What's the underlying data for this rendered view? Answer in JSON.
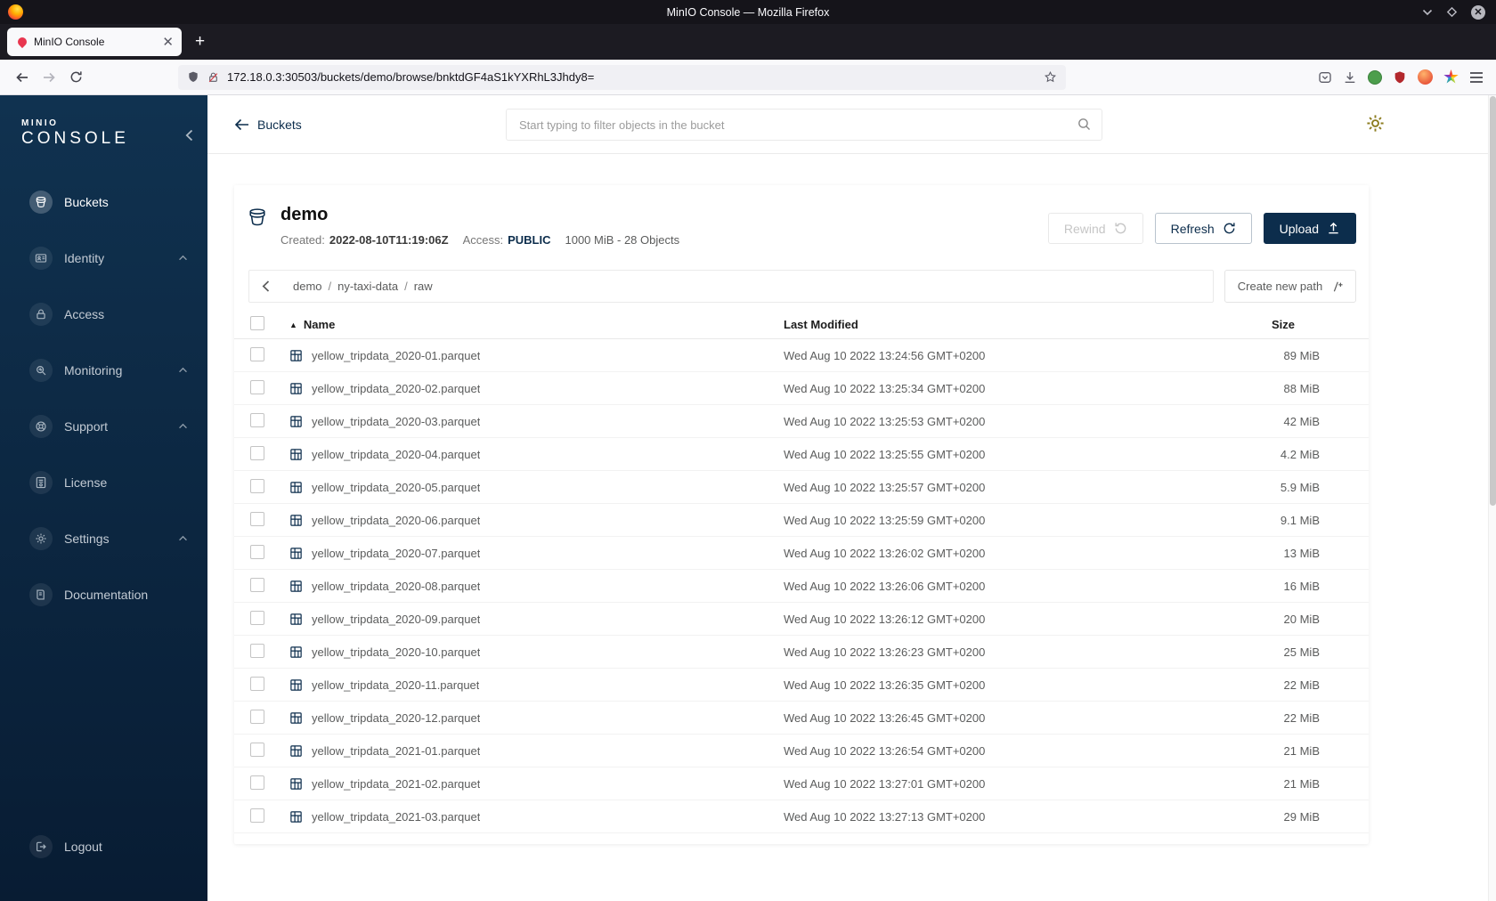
{
  "colors": {
    "accent": "#0C2D4C",
    "sidebar_top": "#103250",
    "sidebar_bottom": "#081C33",
    "gear_gold": "#8D7D20",
    "minio_red": "#E8364F"
  },
  "titlebar": {
    "title": "MinIO Console — Mozilla Firefox"
  },
  "tabbar": {
    "tab_label": "MinIO Console",
    "new_tab_label": "+"
  },
  "navbar": {
    "url": "172.18.0.3:30503/buckets/demo/browse/bnktdGF4aS1kYXRhL3Jhdy8="
  },
  "sidebar": {
    "logo_top": "MINIO",
    "logo_bottom": "CONSOLE",
    "items": [
      {
        "label": "Buckets",
        "active": true,
        "expandable": false
      },
      {
        "label": "Identity",
        "active": false,
        "expandable": true
      },
      {
        "label": "Access",
        "active": false,
        "expandable": false
      },
      {
        "label": "Monitoring",
        "active": false,
        "expandable": true
      },
      {
        "label": "Support",
        "active": false,
        "expandable": true
      },
      {
        "label": "License",
        "active": false,
        "expandable": false
      },
      {
        "label": "Settings",
        "active": false,
        "expandable": true
      },
      {
        "label": "Documentation",
        "active": false,
        "expandable": false
      }
    ],
    "logout_label": "Logout"
  },
  "header": {
    "back_label": "Buckets",
    "search_placeholder": "Start typing to filter objects in the bucket"
  },
  "bucket": {
    "name": "demo",
    "created_label": "Created:",
    "created_value": "2022-08-10T11:19:06Z",
    "access_label": "Access:",
    "access_value": "PUBLIC",
    "usage": "1000 MiB - 28 Objects",
    "rewind_label": "Rewind",
    "refresh_label": "Refresh",
    "upload_label": "Upload"
  },
  "browser": {
    "breadcrumb": [
      "demo",
      "ny-taxi-data",
      "raw"
    ],
    "breadcrumb_separator": "/",
    "create_path_label": "Create new path",
    "sort": "ascending",
    "sort_icon": "▲",
    "columns": {
      "name": "Name",
      "modified": "Last Modified",
      "size": "Size"
    },
    "rows": [
      {
        "name": "yellow_tripdata_2020-01.parquet",
        "modified": "Wed Aug 10 2022 13:24:56 GMT+0200",
        "size": "89 MiB"
      },
      {
        "name": "yellow_tripdata_2020-02.parquet",
        "modified": "Wed Aug 10 2022 13:25:34 GMT+0200",
        "size": "88 MiB"
      },
      {
        "name": "yellow_tripdata_2020-03.parquet",
        "modified": "Wed Aug 10 2022 13:25:53 GMT+0200",
        "size": "42 MiB"
      },
      {
        "name": "yellow_tripdata_2020-04.parquet",
        "modified": "Wed Aug 10 2022 13:25:55 GMT+0200",
        "size": "4.2 MiB"
      },
      {
        "name": "yellow_tripdata_2020-05.parquet",
        "modified": "Wed Aug 10 2022 13:25:57 GMT+0200",
        "size": "5.9 MiB"
      },
      {
        "name": "yellow_tripdata_2020-06.parquet",
        "modified": "Wed Aug 10 2022 13:25:59 GMT+0200",
        "size": "9.1 MiB"
      },
      {
        "name": "yellow_tripdata_2020-07.parquet",
        "modified": "Wed Aug 10 2022 13:26:02 GMT+0200",
        "size": "13 MiB"
      },
      {
        "name": "yellow_tripdata_2020-08.parquet",
        "modified": "Wed Aug 10 2022 13:26:06 GMT+0200",
        "size": "16 MiB"
      },
      {
        "name": "yellow_tripdata_2020-09.parquet",
        "modified": "Wed Aug 10 2022 13:26:12 GMT+0200",
        "size": "20 MiB"
      },
      {
        "name": "yellow_tripdata_2020-10.parquet",
        "modified": "Wed Aug 10 2022 13:26:23 GMT+0200",
        "size": "25 MiB"
      },
      {
        "name": "yellow_tripdata_2020-11.parquet",
        "modified": "Wed Aug 10 2022 13:26:35 GMT+0200",
        "size": "22 MiB"
      },
      {
        "name": "yellow_tripdata_2020-12.parquet",
        "modified": "Wed Aug 10 2022 13:26:45 GMT+0200",
        "size": "22 MiB"
      },
      {
        "name": "yellow_tripdata_2021-01.parquet",
        "modified": "Wed Aug 10 2022 13:26:54 GMT+0200",
        "size": "21 MiB"
      },
      {
        "name": "yellow_tripdata_2021-02.parquet",
        "modified": "Wed Aug 10 2022 13:27:01 GMT+0200",
        "size": "21 MiB"
      },
      {
        "name": "yellow_tripdata_2021-03.parquet",
        "modified": "Wed Aug 10 2022 13:27:13 GMT+0200",
        "size": "29 MiB"
      }
    ]
  }
}
